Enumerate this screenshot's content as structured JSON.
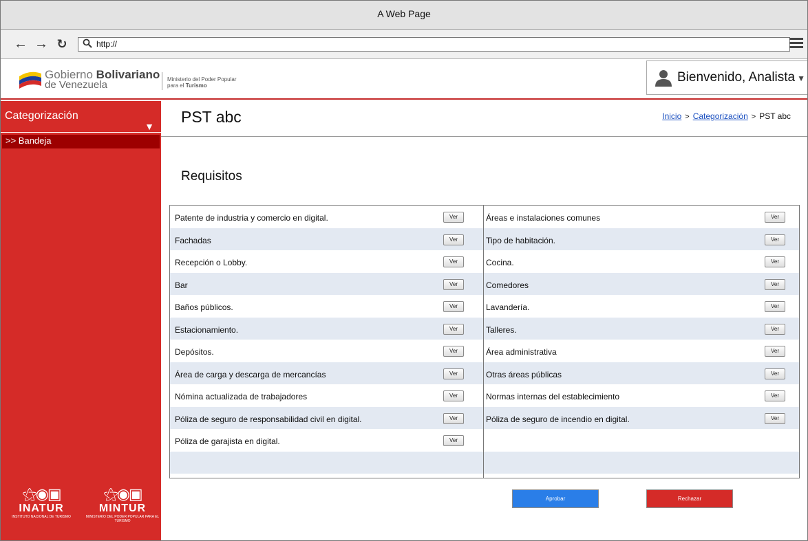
{
  "window": {
    "title": "A Web Page"
  },
  "browser": {
    "url": "http://"
  },
  "header": {
    "gov_name_bold": "Bolivariano",
    "gov_name_pre": "Gobierno ",
    "gov_country": "de Venezuela",
    "ministry_line1": "Ministerio del Poder Popular",
    "ministry_line2_pre": "para el ",
    "ministry_line2_bold": "Turismo",
    "user_greeting": "Bienvenido, Analista"
  },
  "sidebar": {
    "title": "Categorización",
    "items": [
      {
        "label": ">> Bandeja"
      }
    ],
    "logos": [
      {
        "name": "INATUR",
        "sub": "INSTITUTO NACIONAL DE TURISMO"
      },
      {
        "name": "MINTUR",
        "sub": "MINISTERIO DEL PODER POPULAR PARA EL TURISMO"
      }
    ]
  },
  "main": {
    "title": "PST abc",
    "breadcrumb": {
      "home": "Inicio",
      "section": "Categorización",
      "current": "PST abc"
    },
    "section_title": "Requisitos",
    "button_label": "Ver",
    "left_items": [
      "Patente de industria y comercio en digital.",
      "Fachadas",
      "Recepción o Lobby.",
      "Bar",
      "Baños públicos.",
      "Estacionamiento.",
      "Depósitos.",
      "Área de carga y descarga de mercancías",
      "Nómina actualizada de trabajadores",
      "Póliza de seguro de responsabilidad civil en digital.",
      "Póliza de garajista en digital."
    ],
    "right_items": [
      "Áreas e instalaciones comunes",
      "Tipo de habitación.",
      "Cocina.",
      "Comedores",
      "Lavandería.",
      "Talleres.",
      "Área administrativa",
      "Otras áreas públicas",
      "Normas internas del establecimiento",
      "Póliza de seguro de incendio en digital."
    ],
    "approve_label": "Aprobar",
    "reject_label": "Rechazar"
  },
  "colors": {
    "brand_red": "#d52b28",
    "dark_red": "#9d0000",
    "approve_blue": "#2a7ee8",
    "alt_row": "#e3e9f2"
  }
}
